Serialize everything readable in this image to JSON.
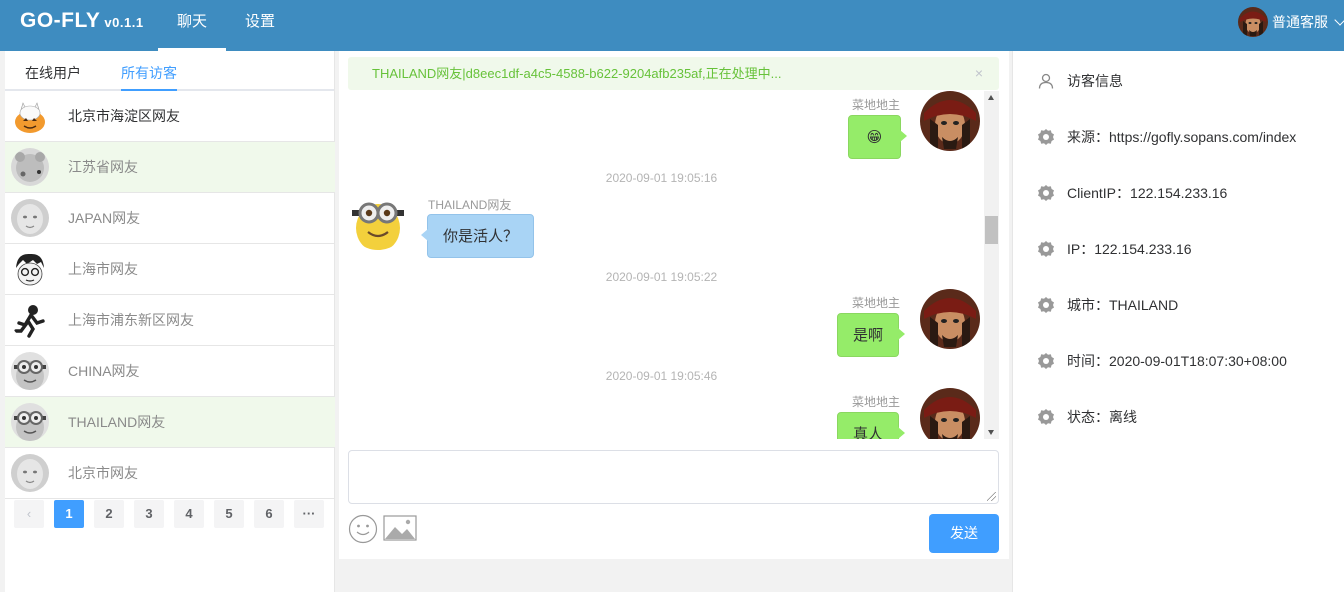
{
  "header": {
    "brand": "GO-FLY",
    "version": "v0.1.1",
    "tabs": [
      {
        "label": "聊天",
        "active": true
      },
      {
        "label": "设置",
        "active": false
      }
    ],
    "user": {
      "name": "普通客服",
      "avatar_icon": "pirate-avatar"
    },
    "bg_color": "#3e8cc0"
  },
  "sidebar": {
    "tabs": [
      {
        "label": "在线用户",
        "active": false
      },
      {
        "label": "所有访客",
        "active": true
      }
    ],
    "visitors": [
      {
        "name": "北京市海淀区网友",
        "online": true,
        "highlighted": false,
        "avatar_icon": "pumpkin-cat-avatar"
      },
      {
        "name": "江苏省网友",
        "online": false,
        "highlighted": true,
        "avatar_icon": "bear-avatar"
      },
      {
        "name": "JAPAN网友",
        "online": false,
        "highlighted": false,
        "avatar_icon": "baby-avatar"
      },
      {
        "name": "上海市网友",
        "online": false,
        "highlighted": false,
        "avatar_icon": "cartoon-boy-avatar"
      },
      {
        "name": "上海市浦东新区网友",
        "online": false,
        "highlighted": false,
        "avatar_icon": "runner-avatar"
      },
      {
        "name": "CHINA网友",
        "online": false,
        "highlighted": false,
        "avatar_icon": "minion-avatar"
      },
      {
        "name": "THAILAND网友",
        "online": false,
        "highlighted": true,
        "avatar_icon": "minion-avatar"
      },
      {
        "name": "北京市网友",
        "online": false,
        "highlighted": false,
        "avatar_icon": "baby-avatar"
      }
    ],
    "pagination": {
      "prev": "‹",
      "pages": [
        "1",
        "2",
        "3",
        "4",
        "5",
        "6"
      ],
      "current": "1",
      "more": "···"
    }
  },
  "chat": {
    "banner": "THAILAND网友|d8eec1df-a4c5-4588-b622-9204afb235af,正在处理中...",
    "banner_close": "×",
    "messages": [
      {
        "side": "me",
        "sender": "菜地地主",
        "text": "😁",
        "time": ""
      },
      {
        "side": "them",
        "sender": "THAILAND网友",
        "text": "你是活人？",
        "time": "2020-09-01 19:05:16"
      },
      {
        "side": "me",
        "sender": "菜地地主",
        "text": "是啊",
        "time": "2020-09-01 19:05:22"
      },
      {
        "side": "me",
        "sender": "菜地地主",
        "text": "真人",
        "time": "2020-09-01 19:05:46"
      }
    ],
    "input_value": "",
    "tools": [
      {
        "icon": "emoji-icon"
      },
      {
        "icon": "image-upload-icon"
      }
    ],
    "send_label": "发送"
  },
  "visitor_info": {
    "title": "访客信息",
    "rows": [
      {
        "label": "来源：",
        "value": "https://gofly.sopans.com/index"
      },
      {
        "label": "ClientIP：",
        "value": "122.154.233.16"
      },
      {
        "label": "IP：",
        "value": "122.154.233.16"
      },
      {
        "label": "城市：",
        "value": "THAILAND"
      },
      {
        "label": "时间：",
        "value": "2020-09-01T18:07:30+08:00"
      },
      {
        "label": "状态：",
        "value": "离线"
      }
    ]
  },
  "colors": {
    "accent": "#409eff",
    "my_bubble": "#95ec69",
    "their_bubble": "#a9d4f5",
    "banner_text": "#67c23a",
    "highlight_row": "#f0f9eb"
  }
}
